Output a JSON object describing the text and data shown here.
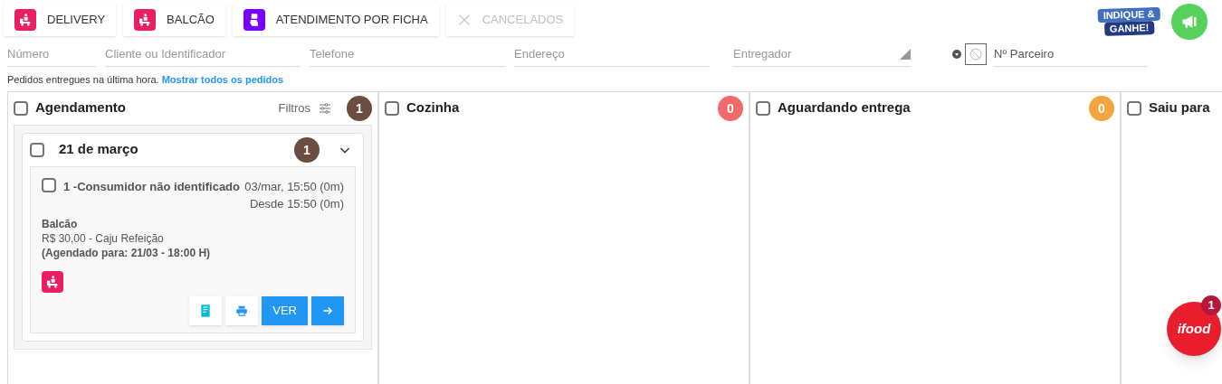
{
  "top_buttons": [
    {
      "label": "DELIVERY",
      "kind": "delivery",
      "disabled": false
    },
    {
      "label": "BALCÃO",
      "kind": "balcao",
      "disabled": false
    },
    {
      "label": "ATENDIMENTO POR FICHA",
      "kind": "ficha",
      "disabled": false
    },
    {
      "label": "CANCELADOS",
      "kind": "cancel",
      "disabled": true
    }
  ],
  "promo": {
    "line1": "INDIQUE &",
    "line2": "GANHE!"
  },
  "filters": [
    {
      "placeholder": "Número",
      "kind": "input"
    },
    {
      "placeholder": "Cliente ou Identificador",
      "kind": "input"
    },
    {
      "placeholder": "Telefone",
      "kind": "input"
    },
    {
      "placeholder": "Endereço",
      "kind": "input"
    },
    {
      "placeholder": "Entregador",
      "kind": "select"
    },
    {
      "placeholder": "Nº Parceiro",
      "kind": "partner"
    }
  ],
  "info": {
    "text": "Pedidos entregues na última hora.",
    "link": "Mostrar todos os pedidos"
  },
  "columns": [
    {
      "title": "Agendamento",
      "checked": false,
      "count": "1",
      "color": "#6d4c41",
      "filter_label": "Filtros",
      "groups": [
        {
          "title": "21 de março",
          "checked": false,
          "count": "1",
          "expanded": true,
          "orders": [
            {
              "checked": false,
              "name": "1 -Consumidor não identificado",
              "time": "03/mar, 15:50 (0m)",
              "since": "Desde 15:50 (0m)",
              "channel": "Balcão",
              "payment": "R$ 30,00 - Caju Refeição",
              "schedule": "(Agendado para: 21/03 - 18:00 H)",
              "view_label": "VER"
            }
          ]
        }
      ]
    },
    {
      "title": "Cozinha",
      "checked": false,
      "count": "0",
      "color": "#f26b6b"
    },
    {
      "title": "Aguardando entrega",
      "checked": false,
      "count": "0",
      "color": "#f4a53f"
    },
    {
      "title": "Saiu para",
      "checked": false
    }
  ],
  "ifood": {
    "logo": "ifood",
    "badge": "1"
  }
}
